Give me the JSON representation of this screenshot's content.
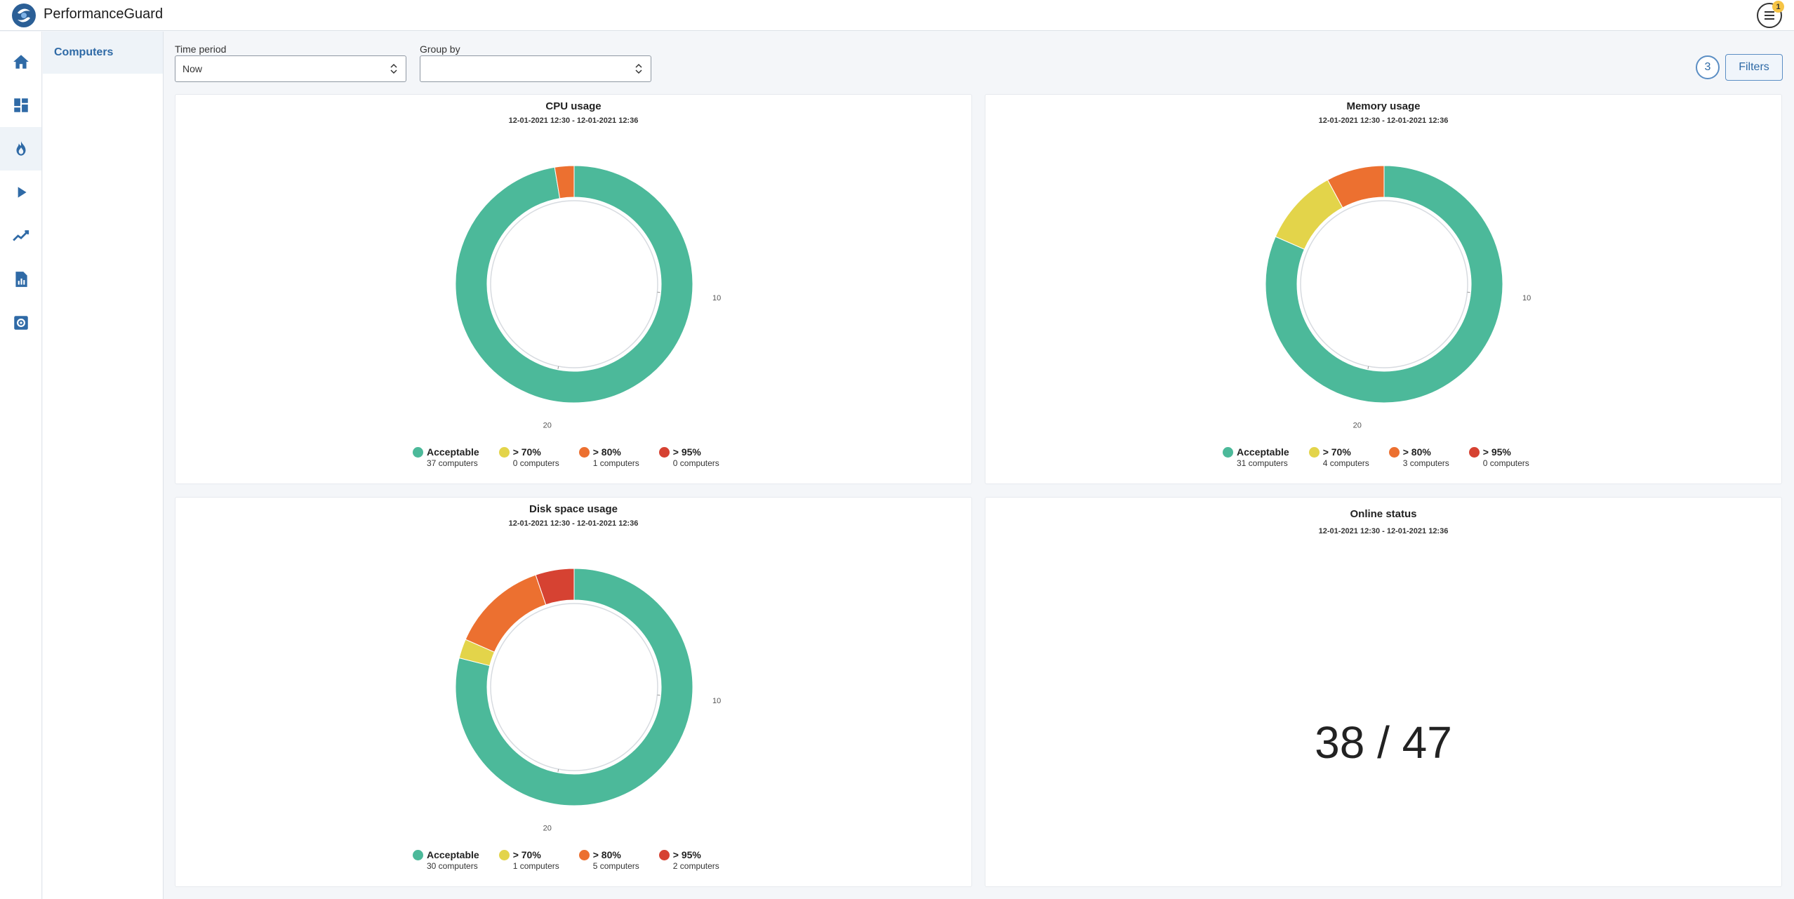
{
  "app": {
    "title": "PerformanceGuard",
    "menu_badge": "1"
  },
  "subnav": {
    "items": [
      {
        "label": "Computers"
      }
    ]
  },
  "controls": {
    "time_period_label": "Time period",
    "time_period_value": "Now",
    "group_by_label": "Group by",
    "group_by_value": "",
    "filter_count": "3",
    "filters_label": "Filters"
  },
  "colors": {
    "acceptable": "#4cb99a",
    "over70": "#e3d44a",
    "over80": "#ec7030",
    "over95": "#d64232"
  },
  "charts": {
    "cpu": {
      "title": "CPU usage",
      "range": "12-01-2021 12:30 - 12-01-2021 12:36",
      "tick_10": "10",
      "tick_20": "20",
      "legend": [
        {
          "label": "Acceptable",
          "count": "37 computers",
          "color": "#4cb99a"
        },
        {
          "label": "> 70%",
          "count": "0 computers",
          "color": "#e3d44a"
        },
        {
          "label": "> 80%",
          "count": "1 computers",
          "color": "#ec7030"
        },
        {
          "label": "> 95%",
          "count": "0 computers",
          "color": "#d64232"
        }
      ]
    },
    "memory": {
      "title": "Memory usage",
      "range": "12-01-2021 12:30 - 12-01-2021 12:36",
      "tick_10": "10",
      "tick_20": "20",
      "legend": [
        {
          "label": "Acceptable",
          "count": "31 computers",
          "color": "#4cb99a"
        },
        {
          "label": "> 70%",
          "count": "4 computers",
          "color": "#e3d44a"
        },
        {
          "label": "> 80%",
          "count": "3 computers",
          "color": "#ec7030"
        },
        {
          "label": "> 95%",
          "count": "0 computers",
          "color": "#d64232"
        }
      ]
    },
    "disk": {
      "title": "Disk space usage",
      "range": "12-01-2021 12:30 - 12-01-2021 12:36",
      "tick_10": "10",
      "tick_20": "20",
      "legend": [
        {
          "label": "Acceptable",
          "count": "30 computers",
          "color": "#4cb99a"
        },
        {
          "label": "> 70%",
          "count": "1 computers",
          "color": "#e3d44a"
        },
        {
          "label": "> 80%",
          "count": "5 computers",
          "color": "#ec7030"
        },
        {
          "label": "> 95%",
          "count": "2 computers",
          "color": "#d64232"
        }
      ]
    },
    "online": {
      "title": "Online status",
      "range": "12-01-2021 12:30 - 12-01-2021 12:36",
      "value": "38 / 47"
    }
  },
  "chart_data": [
    {
      "type": "pie",
      "title": "CPU usage",
      "categories": [
        "Acceptable",
        "> 70%",
        "> 80%",
        "> 95%"
      ],
      "values": [
        37,
        0,
        1,
        0
      ]
    },
    {
      "type": "pie",
      "title": "Memory usage",
      "categories": [
        "Acceptable",
        "> 70%",
        "> 80%",
        "> 95%"
      ],
      "values": [
        31,
        4,
        3,
        0
      ]
    },
    {
      "type": "pie",
      "title": "Disk space usage",
      "categories": [
        "Acceptable",
        "> 70%",
        "> 80%",
        "> 95%"
      ],
      "values": [
        30,
        1,
        5,
        2
      ]
    }
  ]
}
